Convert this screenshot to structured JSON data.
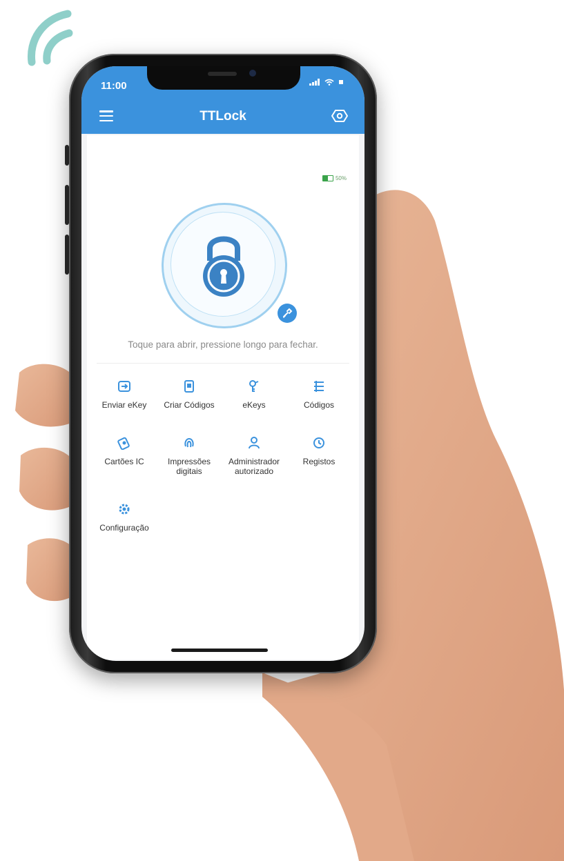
{
  "colors": {
    "accent": "#3b92dd",
    "battery": "#3aa34a",
    "hint_text": "#8a8a8a"
  },
  "status_bar": {
    "time": "11:00",
    "signal_icon": "signal-bars-icon",
    "wifi_icon": "wifi-icon",
    "battery_icon": "battery-icon"
  },
  "app_bar": {
    "title": "TTLock",
    "menu_icon": "hamburger-menu-icon",
    "settings_icon": "settings-gear-icon"
  },
  "lock_screen": {
    "battery_label": "50%",
    "battery_level": 0.5,
    "lock_icon": "padlock-icon",
    "clean_icon": "brush-icon",
    "hint": "Toque para abrir, pressione longo para fechar."
  },
  "menu": {
    "items": [
      {
        "label": "Enviar eKey",
        "icon": "send-key-icon"
      },
      {
        "label": "Criar Códigos",
        "icon": "create-code-icon"
      },
      {
        "label": "eKeys",
        "icon": "ekey-icon"
      },
      {
        "label": "Códigos",
        "icon": "code-list-icon"
      },
      {
        "label": "Cartões IC",
        "icon": "ic-card-icon"
      },
      {
        "label": "Impressões digitais",
        "icon": "fingerprint-icon"
      },
      {
        "label": "Administrador autorizado",
        "icon": "admin-user-icon"
      },
      {
        "label": "Registos",
        "icon": "history-icon"
      },
      {
        "label": "Configuração",
        "icon": "settings-icon"
      }
    ]
  }
}
